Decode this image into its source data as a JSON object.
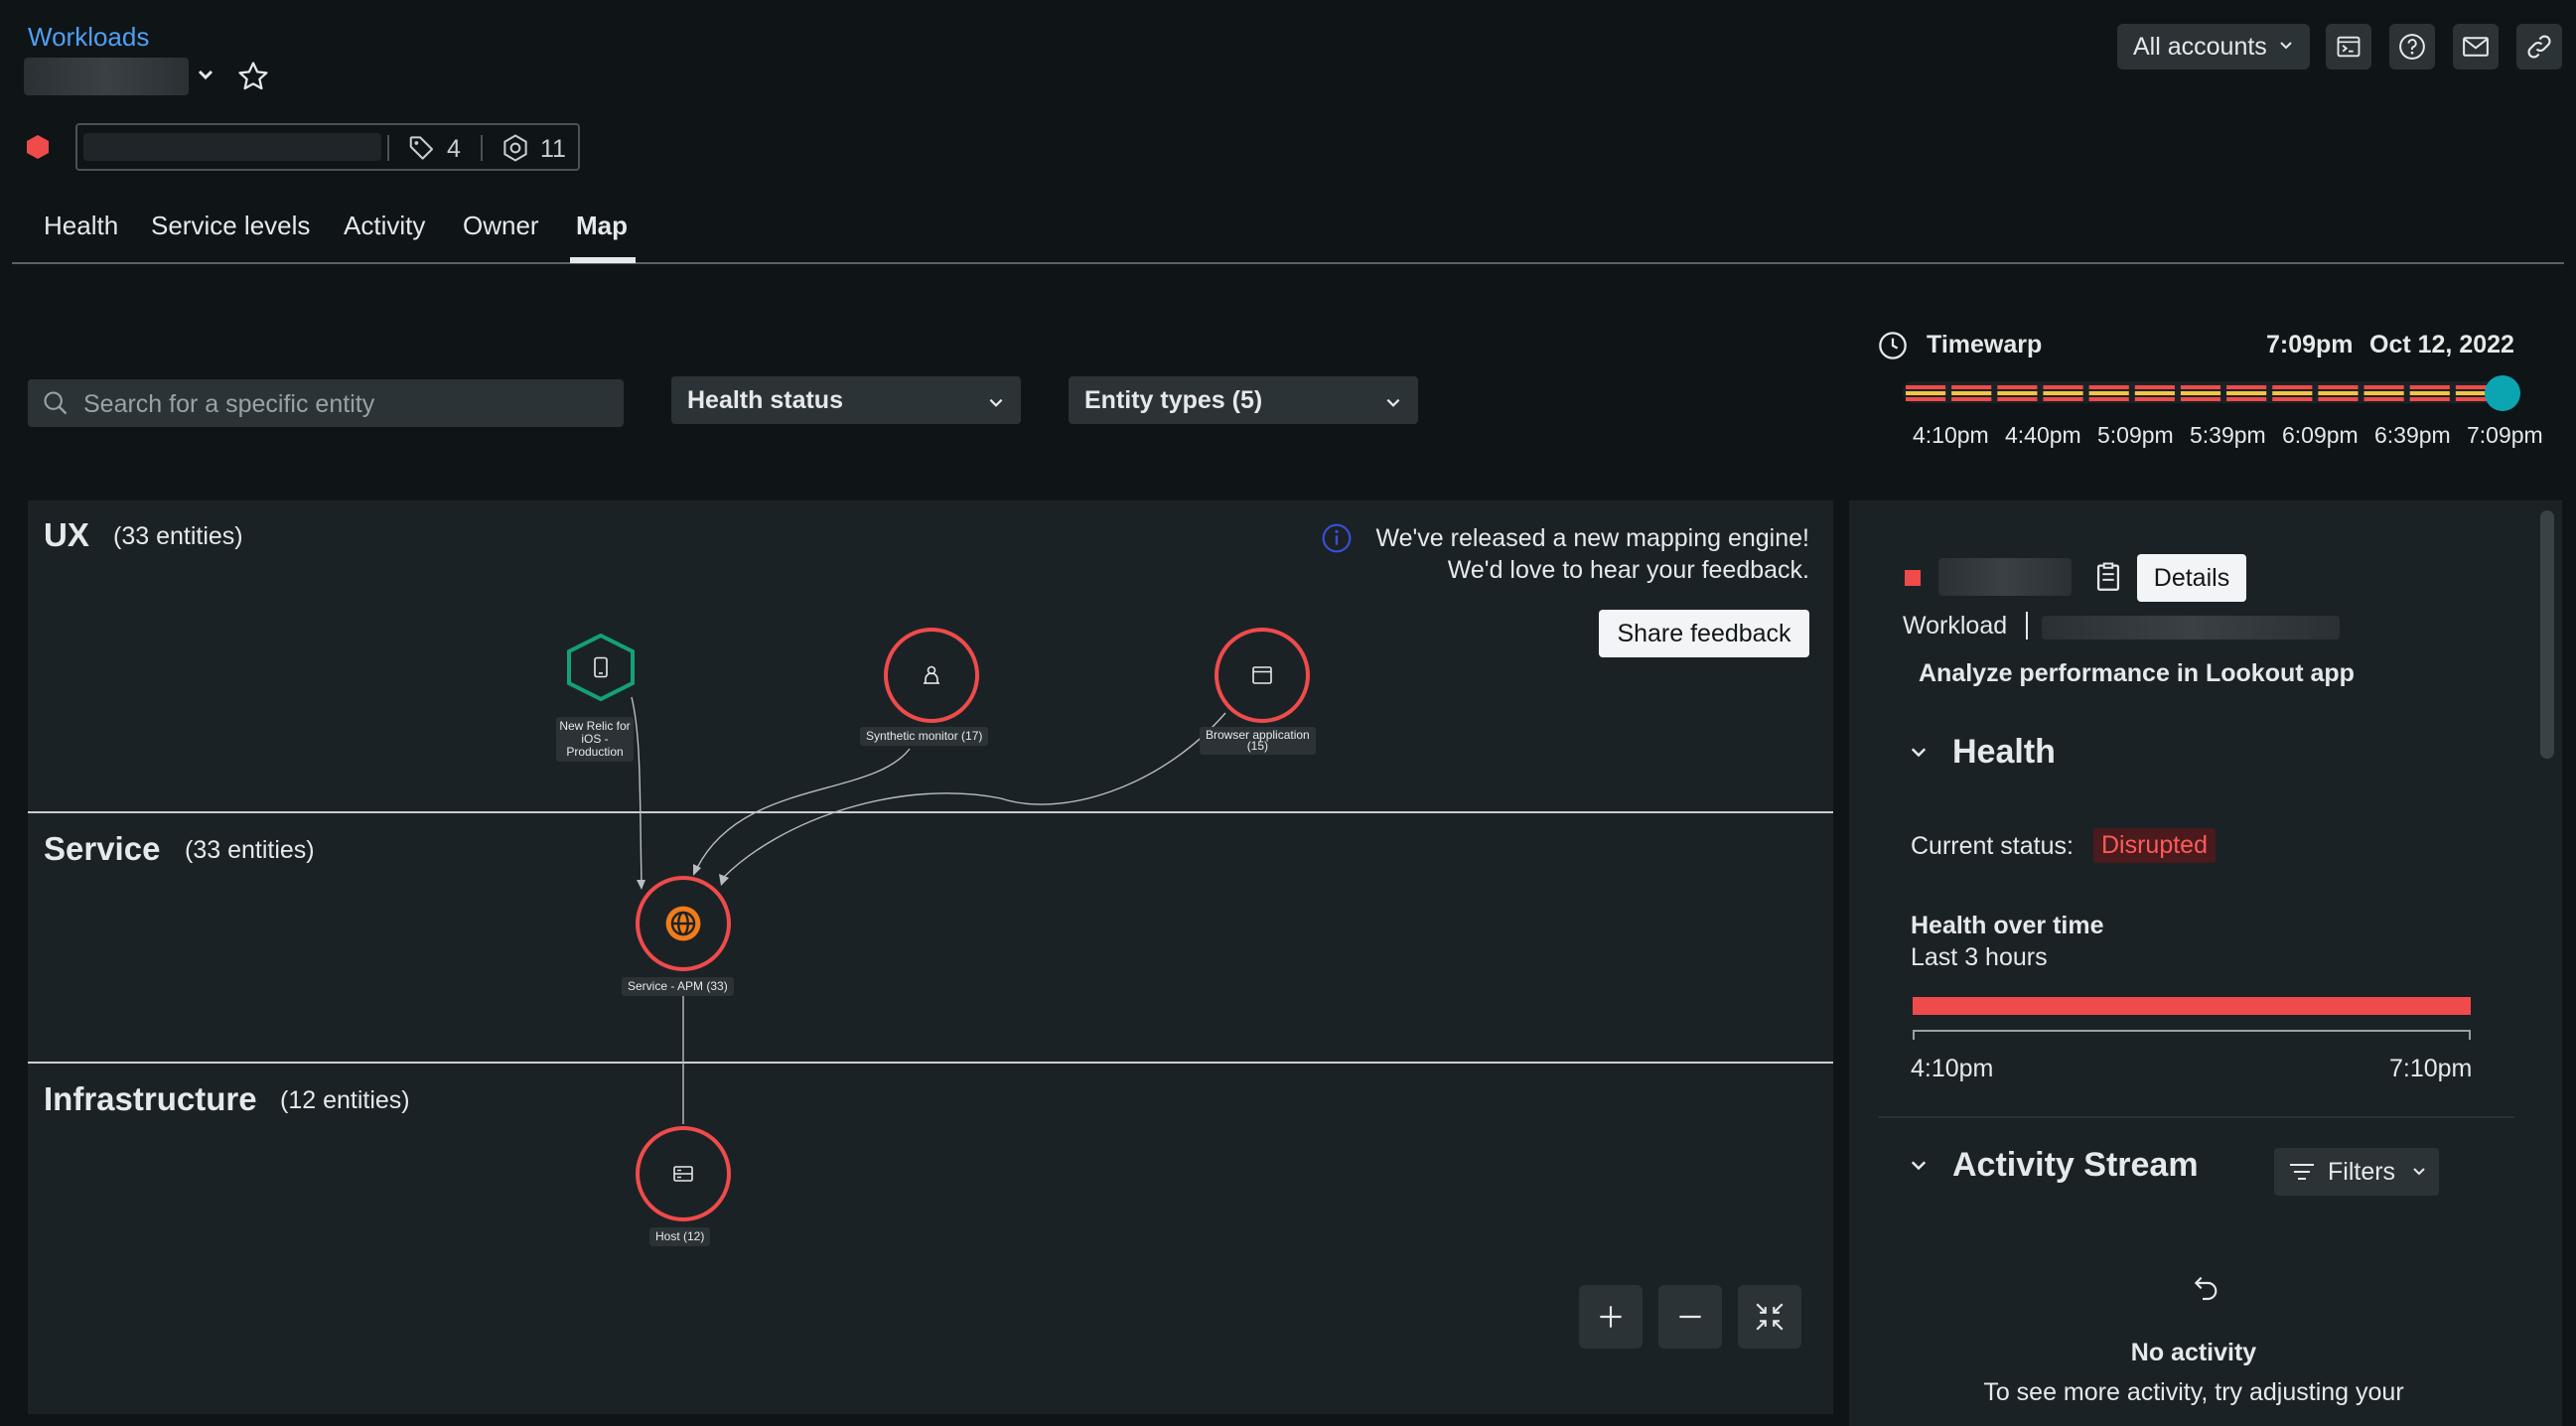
{
  "header": {
    "breadcrumb": "Workloads",
    "tag_count": "4",
    "entity_count": "11",
    "accounts_label": "All accounts"
  },
  "tabs": [
    {
      "label": "Health"
    },
    {
      "label": "Service levels"
    },
    {
      "label": "Activity"
    },
    {
      "label": "Owner"
    },
    {
      "label": "Map"
    }
  ],
  "filters": {
    "search_placeholder": "Search for a specific entity",
    "health_status": "Health status",
    "entity_types": "Entity types (5)"
  },
  "timewarp": {
    "label": "Timewarp",
    "time": "7:09pm",
    "date": "Oct 12, 2022",
    "ticks": [
      "4:10pm",
      "4:40pm",
      "5:09pm",
      "5:39pm",
      "6:09pm",
      "6:39pm",
      "7:09pm"
    ]
  },
  "map": {
    "notice_line1": "We've released a new mapping engine!",
    "notice_line2": "We'd love to hear your feedback.",
    "share_feedback": "Share feedback",
    "lanes": [
      {
        "title": "UX",
        "count": "(33 entities)"
      },
      {
        "title": "Service",
        "count": "(33 entities)"
      },
      {
        "title": "Infrastructure",
        "count": "(12 entities)"
      }
    ],
    "nodes": {
      "ios_line1": "New Relic for",
      "ios_line2": "iOS -",
      "ios_line3": "Production",
      "synthetic": "Synthetic monitor (17)",
      "browser_line1": "Browser application",
      "browser_line2": "(15)",
      "apm": "Service - APM (33)",
      "host": "Host (12)"
    }
  },
  "panel": {
    "details_button": "Details",
    "workload_label": "Workload",
    "lookout_link": "Analyze performance in Lookout app",
    "health_title": "Health",
    "current_status_label": "Current status:",
    "current_status_value": "Disrupted",
    "health_over_time": "Health over time",
    "last_3_hours": "Last 3 hours",
    "range_start": "4:10pm",
    "range_end": "7:10pm",
    "activity_title": "Activity Stream",
    "filters_button": "Filters",
    "no_activity": "No activity",
    "no_activity_hint": "To see more activity, try adjusting your"
  },
  "colors": {
    "critical": "#ef4b4b",
    "healthy": "#13a07a",
    "warning": "#f5c542",
    "accent": "#0aa5b0",
    "link": "#4f9ff5"
  }
}
